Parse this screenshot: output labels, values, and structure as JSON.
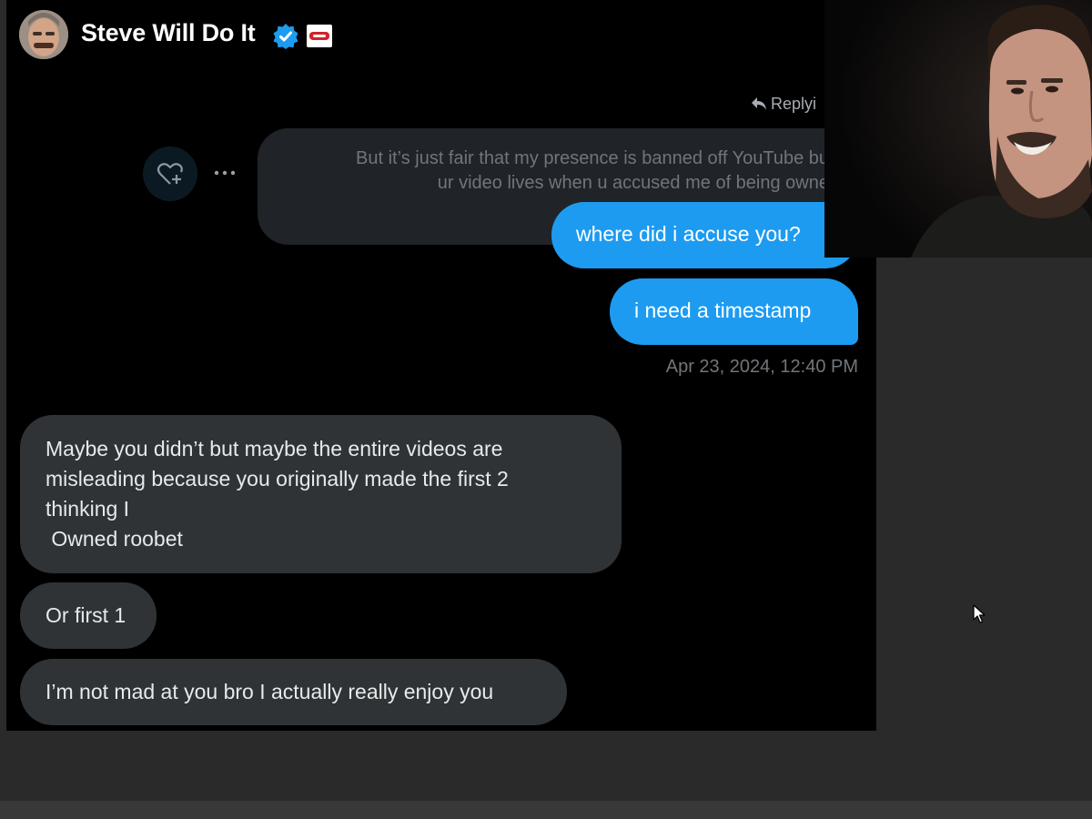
{
  "header": {
    "display_name": "Steve Will Do It",
    "verified": true
  },
  "reply_indicator": {
    "label": "Replyi"
  },
  "quoted_message": {
    "lines": [
      "But it’s just fair that my presence is banned off YouTube bu",
      "ur video lives when u accused me of being owne"
    ]
  },
  "messages_sent": [
    {
      "text": "where did i accuse you?"
    },
    {
      "text": "i need a timestamp"
    }
  ],
  "timestamp": "Apr 23, 2024, 12:40 PM",
  "messages_received": [
    {
      "lines": [
        "Maybe you didn’t but maybe the entire videos are",
        "misleading because you originally made the first 2",
        "thinking I",
        " Owned roobet"
      ]
    },
    {
      "text": "Or first 1"
    },
    {
      "text": "I’m not mad at you bro I actually really enjoy you"
    }
  ],
  "colors": {
    "sent_bubble": "#1d9bf0",
    "received_bubble": "#2f3336",
    "background": "#000000",
    "verified_badge": "#1d9bf0"
  },
  "icons": [
    "verified-badge-icon",
    "reply-arrow-icon",
    "heart-plus-icon",
    "more-dots-icon",
    "mouse-cursor-icon"
  ]
}
